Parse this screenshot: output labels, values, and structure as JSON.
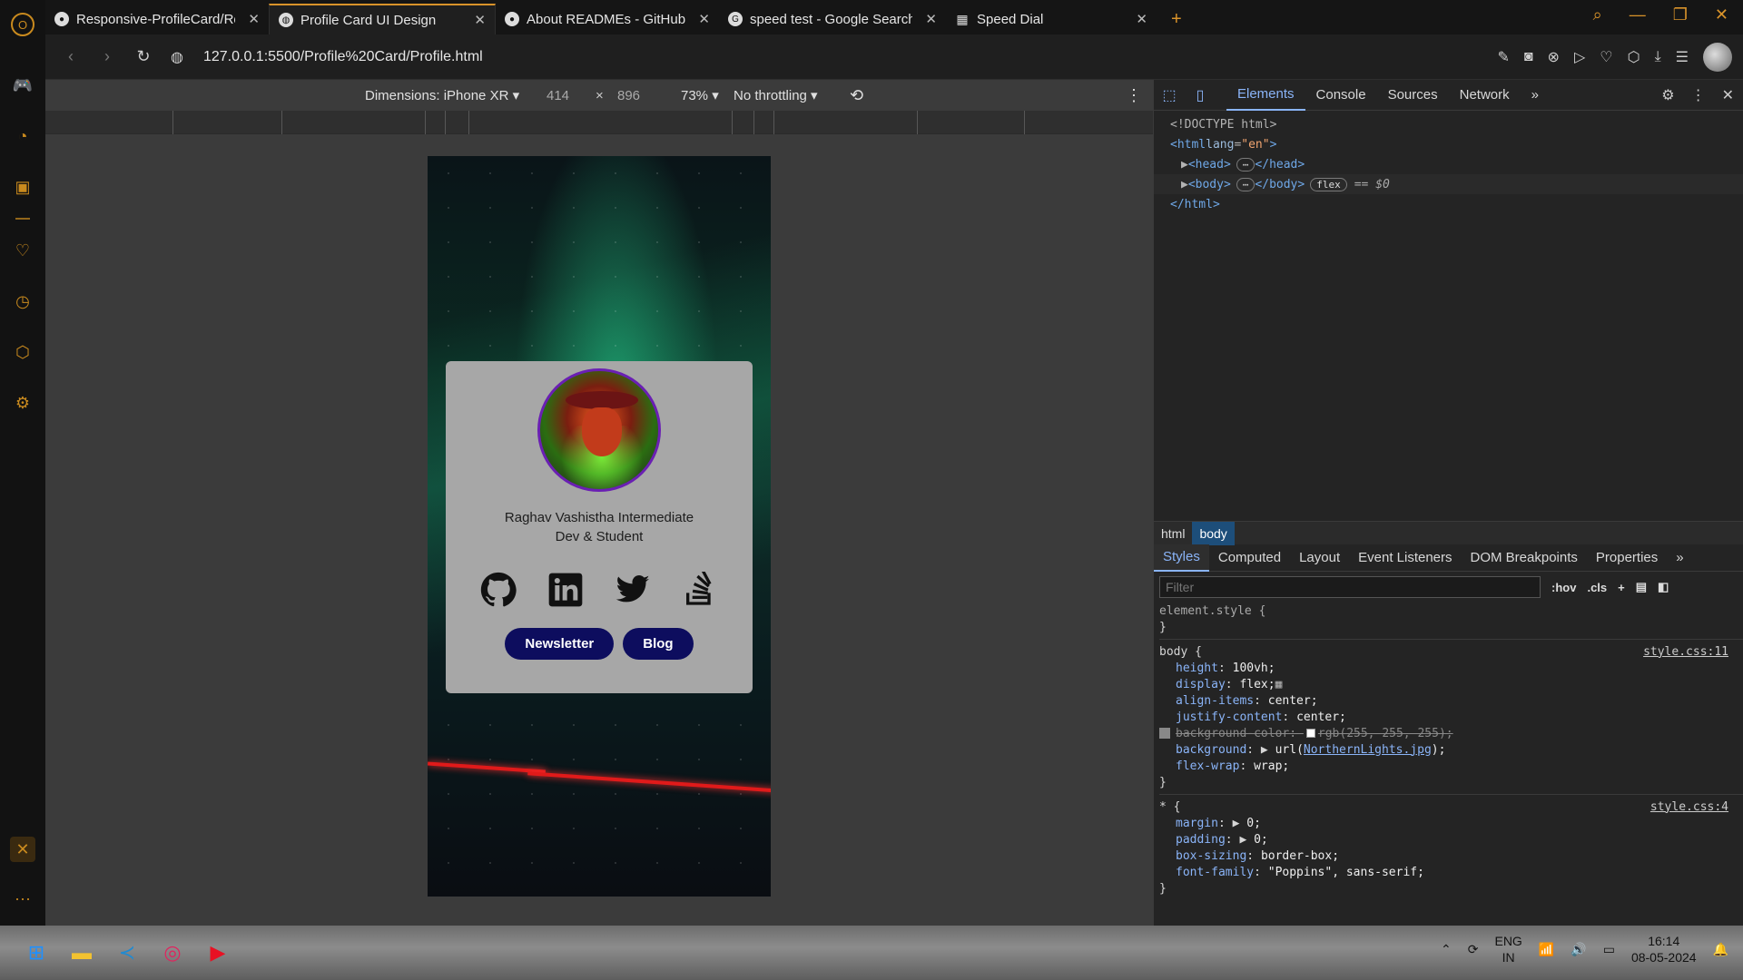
{
  "tabs": [
    {
      "title": "Responsive-ProfileCard/Re",
      "favicon": "github-icon",
      "active": false
    },
    {
      "title": "Profile Card UI Design",
      "favicon": "globe-icon",
      "active": true
    },
    {
      "title": "About READMEs - GitHub I",
      "favicon": "github-icon",
      "active": false
    },
    {
      "title": "speed test - Google Search",
      "favicon": "google-icon",
      "active": false
    },
    {
      "title": "Speed Dial",
      "favicon": "speed-dial-icon",
      "active": false
    }
  ],
  "address": {
    "url": "127.0.0.1:5500/Profile%20Card/Profile.html"
  },
  "emulation": {
    "dimensions": "Dimensions: iPhone XR",
    "width": "414",
    "height": "896",
    "zoom": "73%",
    "throttle": "No throttling"
  },
  "card": {
    "name_line": "Raghav Vashistha Intermediate Dev & Student",
    "buttons": {
      "newsletter": "Newsletter",
      "blog": "Blog"
    }
  },
  "devtools": {
    "tabs": [
      "Elements",
      "Console",
      "Sources",
      "Network"
    ],
    "dom": {
      "doctype": "<!DOCTYPE html>",
      "html_open": "<html",
      "html_attr": "lang",
      "html_val": "\"en\"",
      "head": "<head>",
      "head_close": "</head>",
      "body": "<body>",
      "body_close": "</body>",
      "flex_badge": "flex",
      "dollar": "== $0",
      "html_close": "</html>"
    },
    "breadcrumbs": [
      "html",
      "body"
    ],
    "subtabs": [
      "Styles",
      "Computed",
      "Layout",
      "Event Listeners",
      "DOM Breakpoints",
      "Properties"
    ],
    "filter_placeholder": "Filter",
    "hov": ":hov",
    "cls": ".cls",
    "styles": {
      "element_style": "element.style {",
      "close": "}",
      "body_sel": "body {",
      "body_src": "style.css:11",
      "height": "100vh;",
      "display": "flex;",
      "align_items": "center;",
      "justify_content": "center;",
      "bg_color": "rgb(255, 255, 255);",
      "background_pre": "url(",
      "background_link": "NorthernLights.jpg",
      "background_post": ");",
      "flex_wrap": "wrap;",
      "star_sel": "* {",
      "star_src": "style.css:4",
      "margin": "0;",
      "padding": "0;",
      "box_sizing": "border-box;",
      "font_family": "\"Poppins\", sans-serif;"
    }
  },
  "taskbar": {
    "lang1": "ENG",
    "lang2": "IN",
    "time": "16:14",
    "date": "08-05-2024"
  },
  "colors": {
    "accent": "#d9932a",
    "devtools_blue": "#8ab4f8",
    "card_button": "#0d0d5e",
    "avatar_ring": "#6a1fb3"
  }
}
